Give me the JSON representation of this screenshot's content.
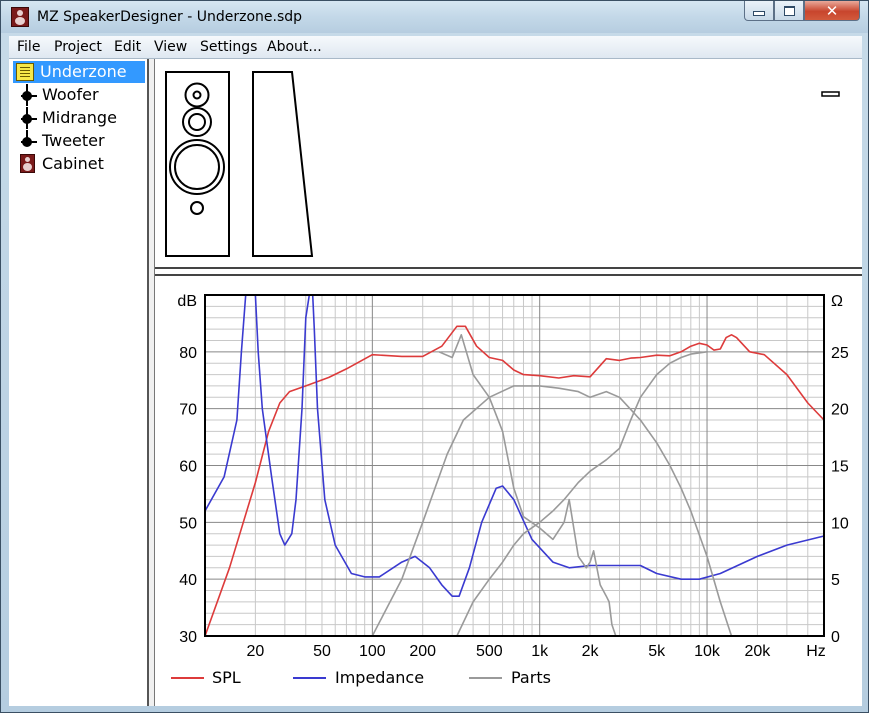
{
  "window": {
    "title": "MZ SpeakerDesigner - Underzone.sdp",
    "buttons": {
      "minimize": "▭",
      "maximize": "□",
      "close": "✕"
    }
  },
  "menu": [
    "File",
    "Project",
    "Edit",
    "View",
    "Settings",
    "About..."
  ],
  "tree": {
    "project": "Underzone",
    "items": [
      "Woofer",
      "Midrange",
      "Tweeter",
      "Cabinet"
    ]
  },
  "chart_data": {
    "type": "line",
    "x_scale": "log",
    "xlim": [
      10,
      50000
    ],
    "x_unit": "Hz",
    "x_ticks": [
      {
        "value": 20,
        "label": "20"
      },
      {
        "value": 50,
        "label": "50"
      },
      {
        "value": 100,
        "label": "100"
      },
      {
        "value": 200,
        "label": "200"
      },
      {
        "value": 500,
        "label": "500"
      },
      {
        "value": 1000,
        "label": "1k"
      },
      {
        "value": 2000,
        "label": "2k"
      },
      {
        "value": 5000,
        "label": "5k"
      },
      {
        "value": 10000,
        "label": "10k"
      },
      {
        "value": 20000,
        "label": "20k"
      }
    ],
    "y_left": {
      "label": "dB",
      "lim": [
        30,
        90
      ],
      "ticks": [
        30,
        40,
        50,
        60,
        70,
        80
      ]
    },
    "y_right": {
      "label": "Ω",
      "lim": [
        0,
        30
      ],
      "ticks": [
        0,
        5,
        10,
        15,
        20,
        25
      ]
    },
    "grid": true,
    "legend_position": "bottom",
    "series": [
      {
        "name": "SPL",
        "axis": "left",
        "color": "#dd3b3b",
        "points": [
          [
            10,
            30
          ],
          [
            14,
            42
          ],
          [
            20,
            57
          ],
          [
            24,
            66
          ],
          [
            28,
            71
          ],
          [
            32,
            73
          ],
          [
            40,
            74
          ],
          [
            55,
            75.5
          ],
          [
            70,
            77
          ],
          [
            100,
            79.5
          ],
          [
            150,
            79.2
          ],
          [
            200,
            79.2
          ],
          [
            260,
            81
          ],
          [
            320,
            84.5
          ],
          [
            360,
            84.5
          ],
          [
            420,
            81
          ],
          [
            500,
            79
          ],
          [
            600,
            78.5
          ],
          [
            700,
            76.8
          ],
          [
            800,
            76
          ],
          [
            1000,
            75.8
          ],
          [
            1300,
            75.4
          ],
          [
            1600,
            75.8
          ],
          [
            2000,
            75.6
          ],
          [
            2500,
            78.8
          ],
          [
            3000,
            78.5
          ],
          [
            3500,
            78.9
          ],
          [
            4000,
            79
          ],
          [
            5000,
            79.4
          ],
          [
            6000,
            79.3
          ],
          [
            7000,
            80
          ],
          [
            8000,
            81
          ],
          [
            9000,
            81.5
          ],
          [
            10000,
            81.2
          ],
          [
            11000,
            80.3
          ],
          [
            12000,
            80.5
          ],
          [
            13000,
            82.5
          ],
          [
            14000,
            83
          ],
          [
            15000,
            82.5
          ],
          [
            18000,
            80
          ],
          [
            22000,
            79.5
          ],
          [
            30000,
            76
          ],
          [
            40000,
            71
          ],
          [
            50000,
            68
          ]
        ]
      },
      {
        "name": "Impedance",
        "axis": "right",
        "color": "#3a3ad0",
        "points": [
          [
            10,
            11
          ],
          [
            13,
            14
          ],
          [
            15.5,
            19
          ],
          [
            16.5,
            25
          ],
          [
            17.5,
            30
          ],
          [
            20,
            30
          ],
          [
            20.8,
            25
          ],
          [
            22,
            20
          ],
          [
            25,
            14
          ],
          [
            28,
            9
          ],
          [
            30,
            8
          ],
          [
            33,
            9
          ],
          [
            35,
            12
          ],
          [
            38,
            20
          ],
          [
            40,
            28
          ],
          [
            42,
            30
          ],
          [
            44,
            30
          ],
          [
            45,
            27
          ],
          [
            47,
            20
          ],
          [
            52,
            12
          ],
          [
            60,
            8
          ],
          [
            75,
            5.5
          ],
          [
            90,
            5.2
          ],
          [
            110,
            5.2
          ],
          [
            150,
            6.5
          ],
          [
            180,
            7
          ],
          [
            220,
            6
          ],
          [
            260,
            4.5
          ],
          [
            300,
            3.5
          ],
          [
            330,
            3.5
          ],
          [
            380,
            6
          ],
          [
            450,
            10
          ],
          [
            550,
            13
          ],
          [
            600,
            13.2
          ],
          [
            700,
            12
          ],
          [
            900,
            8.5
          ],
          [
            1200,
            6.5
          ],
          [
            1500,
            6
          ],
          [
            2000,
            6.2
          ],
          [
            3000,
            6.2
          ],
          [
            4000,
            6.2
          ],
          [
            5000,
            5.5
          ],
          [
            7000,
            5
          ],
          [
            9000,
            5
          ],
          [
            12000,
            5.5
          ],
          [
            20000,
            7
          ],
          [
            30000,
            8
          ],
          [
            50000,
            8.8
          ]
        ]
      },
      {
        "name": "Parts",
        "axis": "right",
        "color": "#9a9a9a",
        "points": [
          [
            250,
            25
          ],
          [
            300,
            24.5
          ],
          [
            340,
            26.5
          ],
          [
            400,
            23
          ],
          [
            500,
            21
          ],
          [
            600,
            18
          ],
          [
            700,
            13
          ],
          [
            800,
            10.5
          ],
          [
            1000,
            9.5
          ],
          [
            1200,
            8.5
          ],
          [
            1400,
            10
          ],
          [
            1500,
            12
          ],
          [
            1700,
            7
          ],
          [
            1900,
            6
          ],
          [
            2000,
            6.5
          ],
          [
            2100,
            7.5
          ],
          [
            2300,
            4.5
          ],
          [
            2500,
            3.5
          ],
          [
            2600,
            3
          ],
          [
            2700,
            1
          ],
          [
            2850,
            0
          ]
        ]
      },
      {
        "name": "Parts",
        "axis": "right",
        "color": "#9a9a9a",
        "points": [
          [
            100,
            0
          ],
          [
            150,
            5
          ],
          [
            200,
            10
          ],
          [
            280,
            16
          ],
          [
            350,
            19
          ],
          [
            500,
            21
          ],
          [
            700,
            22
          ],
          [
            1000,
            22
          ],
          [
            1300,
            21.8
          ],
          [
            1700,
            21.5
          ],
          [
            2000,
            21
          ],
          [
            2500,
            21.5
          ],
          [
            3000,
            21
          ],
          [
            4000,
            19
          ],
          [
            5000,
            17
          ],
          [
            6000,
            15
          ],
          [
            7000,
            13
          ],
          [
            8000,
            11
          ],
          [
            10000,
            7
          ],
          [
            12000,
            3
          ],
          [
            14000,
            0
          ]
        ]
      },
      {
        "name": "Parts",
        "axis": "right",
        "color": "#9a9a9a",
        "points": [
          [
            320,
            0
          ],
          [
            400,
            3
          ],
          [
            500,
            5
          ],
          [
            600,
            6.5
          ],
          [
            700,
            8
          ],
          [
            800,
            9
          ],
          [
            1000,
            10
          ],
          [
            1200,
            11
          ],
          [
            1400,
            12
          ],
          [
            1700,
            13.5
          ],
          [
            2000,
            14.5
          ],
          [
            2500,
            15.5
          ],
          [
            3000,
            16.5
          ],
          [
            3500,
            19
          ],
          [
            4000,
            21
          ],
          [
            5000,
            23
          ],
          [
            6000,
            24
          ],
          [
            7000,
            24.5
          ],
          [
            8000,
            24.8
          ],
          [
            10000,
            25
          ]
        ]
      }
    ],
    "legend": [
      {
        "label": "SPL",
        "color": "#dd3b3b"
      },
      {
        "label": "Impedance",
        "color": "#3a3ad0"
      },
      {
        "label": "Parts",
        "color": "#9a9a9a"
      }
    ]
  }
}
